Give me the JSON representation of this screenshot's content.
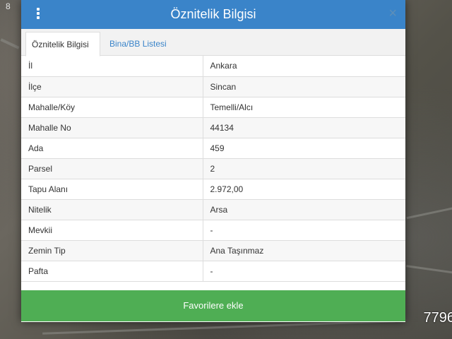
{
  "dialog": {
    "title": "Öznitelik Bilgisi",
    "close_glyph": "×",
    "menu_icon": "vertical-ellipsis-icon",
    "tabs": [
      {
        "label": "Öznitelik Bilgisi",
        "active": true
      },
      {
        "label": "Bina/BB Listesi",
        "active": false
      }
    ],
    "rows": [
      {
        "key": "İl",
        "value": "Ankara"
      },
      {
        "key": "İlçe",
        "value": "Sincan"
      },
      {
        "key": "Mahalle/Köy",
        "value": "Temelli/Alcı"
      },
      {
        "key": "Mahalle No",
        "value": "44134"
      },
      {
        "key": "Ada",
        "value": "459"
      },
      {
        "key": "Parsel",
        "value": "2"
      },
      {
        "key": "Tapu Alanı",
        "value": "2.972,00"
      },
      {
        "key": "Nitelik",
        "value": "Arsa"
      },
      {
        "key": "Mevkii",
        "value": "-"
      },
      {
        "key": "Zemin Tip",
        "value": "Ana Taşınmaz"
      },
      {
        "key": "Pafta",
        "value": "-"
      }
    ],
    "favorite_button": "Favorilere ekle"
  },
  "map": {
    "scale_text": "7796",
    "corner_marker": "8"
  },
  "colors": {
    "header": "#3a84c9",
    "button": "#4fae54",
    "tab_link": "#3a84c9"
  }
}
